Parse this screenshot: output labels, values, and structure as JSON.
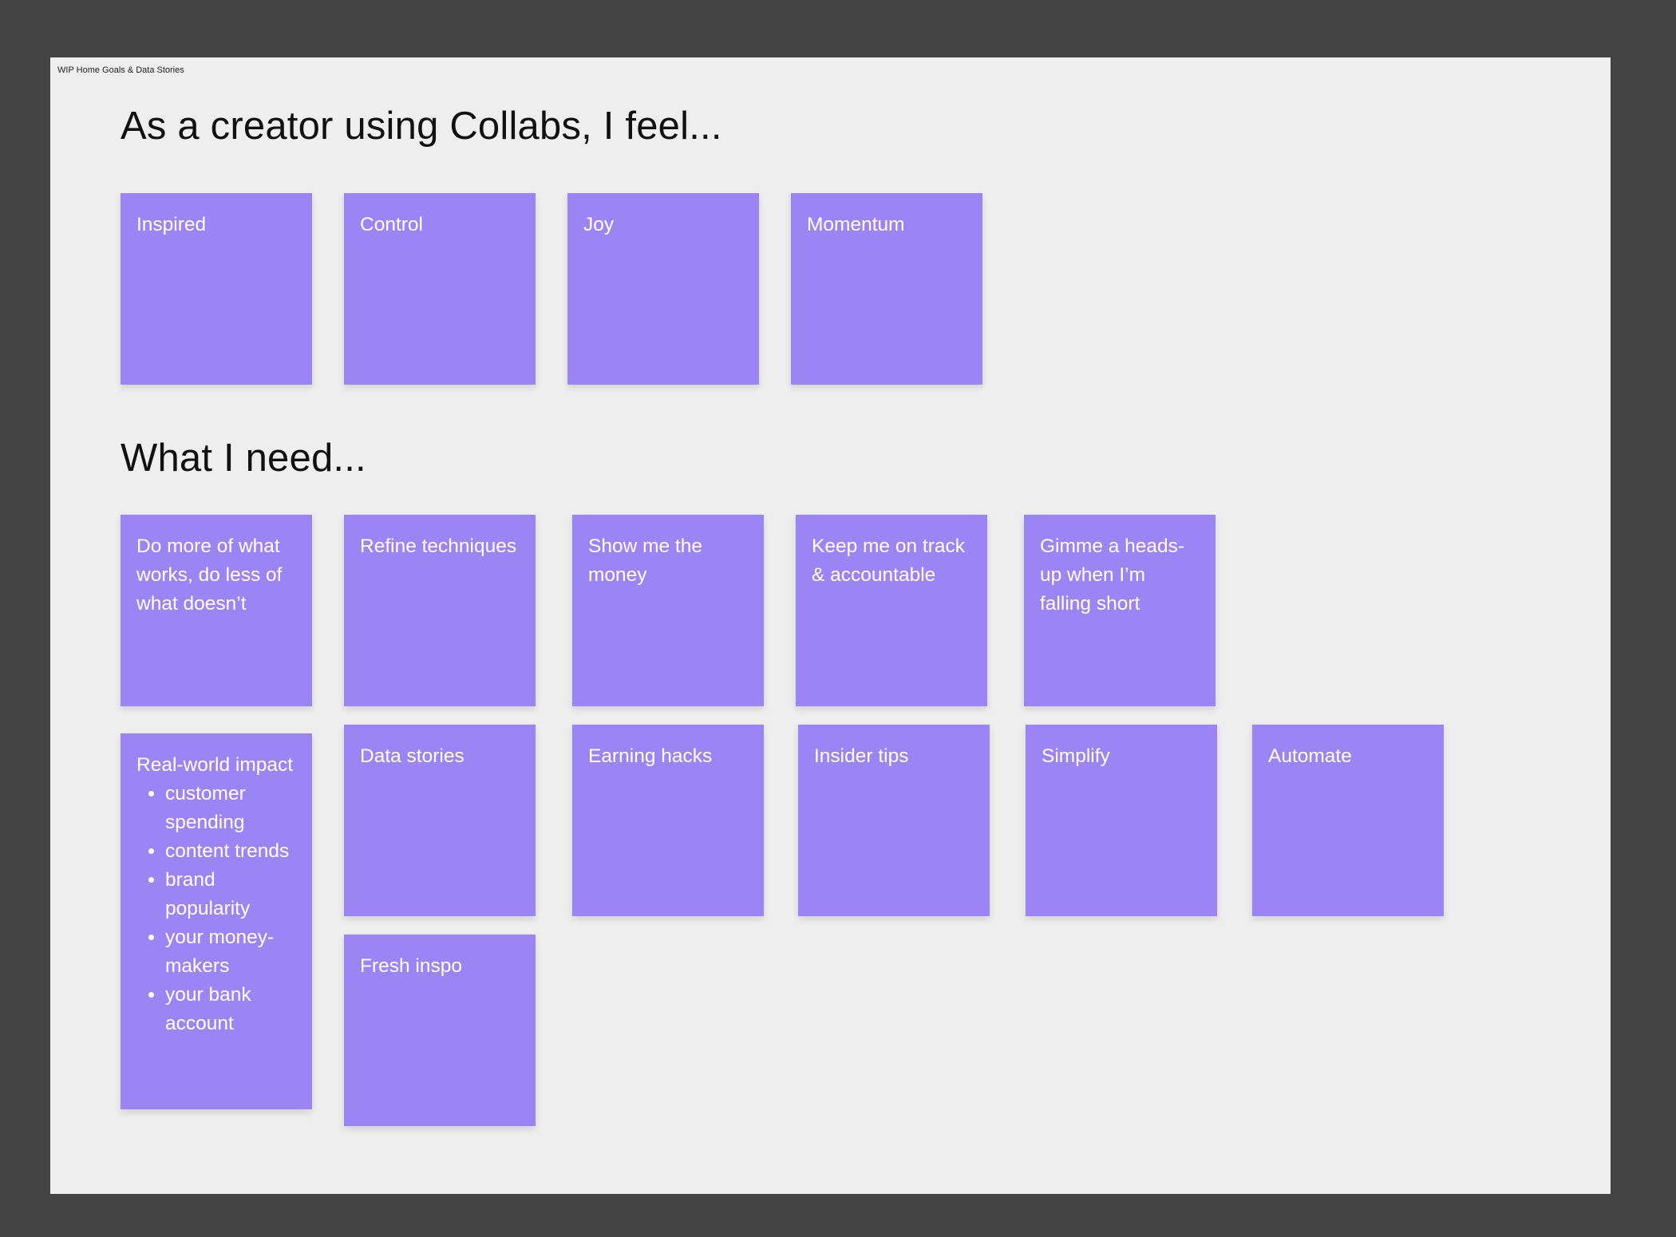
{
  "frame": {
    "label": "WIP Home Goals & Data Stories"
  },
  "sections": {
    "feel": {
      "heading": "As a creator using Collabs, I feel..."
    },
    "need": {
      "heading": "What I need..."
    }
  },
  "colors": {
    "canvas": "#444444",
    "frame": "#eeeeee",
    "sticky": "#9b85f5",
    "sticky_text": "#ffffff"
  },
  "feel_notes": [
    "Inspired",
    "Control",
    "Joy",
    "Momentum"
  ],
  "need_notes": {
    "row1": [
      "Do more of what works, do less of what doesn’t",
      "Refine techniques",
      "Show me the money",
      "Keep me on track & accountable",
      "Gimme a heads-up when I’m falling short"
    ],
    "real_world": {
      "title": "Real-world impact",
      "items": [
        "customer spending",
        "content trends",
        "brand popularity",
        "your money-makers",
        "your bank account"
      ]
    },
    "row2": [
      "Data stories",
      "Earning hacks",
      "Insider tips",
      "Simplify",
      "Automate"
    ],
    "row3": [
      "Fresh inspo"
    ]
  }
}
